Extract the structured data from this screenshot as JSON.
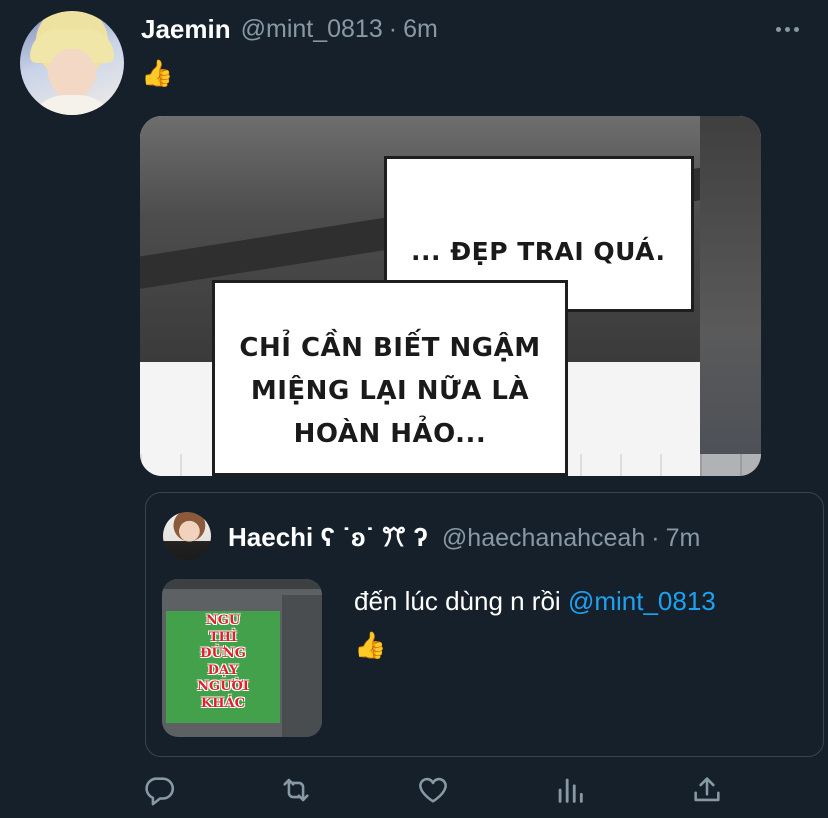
{
  "tweet": {
    "display_name": "Jaemin",
    "handle": "@mint_0813",
    "separator": "·",
    "time": "6m",
    "text": "👍",
    "media_image": {
      "bubble_top": "... ĐẸP TRAI QUÁ.",
      "bubble_bottom_lines": [
        "CHỈ CẦN BIẾT NGẬM",
        "MIỆNG LẠI NỮA LÀ",
        "HOÀN HẢO..."
      ]
    }
  },
  "quoted_tweet": {
    "display_name": "Haechi ʕ ˙ʚ˙ ꔫ ʔ",
    "handle": "@haechanahceah",
    "separator": "·",
    "time": "7m",
    "text_before": "đến lúc dùng n rồi ",
    "mention": "@mint_0813",
    "text_line2": "👍",
    "media_image": {
      "caption_lines": [
        "NGU",
        "THÌ",
        "ĐỪNG",
        "DẠY",
        "NGƯỜI",
        "KHÁC"
      ]
    }
  },
  "icons": [
    "more-icon",
    "reply-icon",
    "retweet-icon",
    "like-icon",
    "analytics-icon",
    "share-icon"
  ],
  "colors": {
    "background": "#15202b",
    "secondary_text": "#8899a6",
    "link": "#1da1f2",
    "border": "#38444d"
  }
}
